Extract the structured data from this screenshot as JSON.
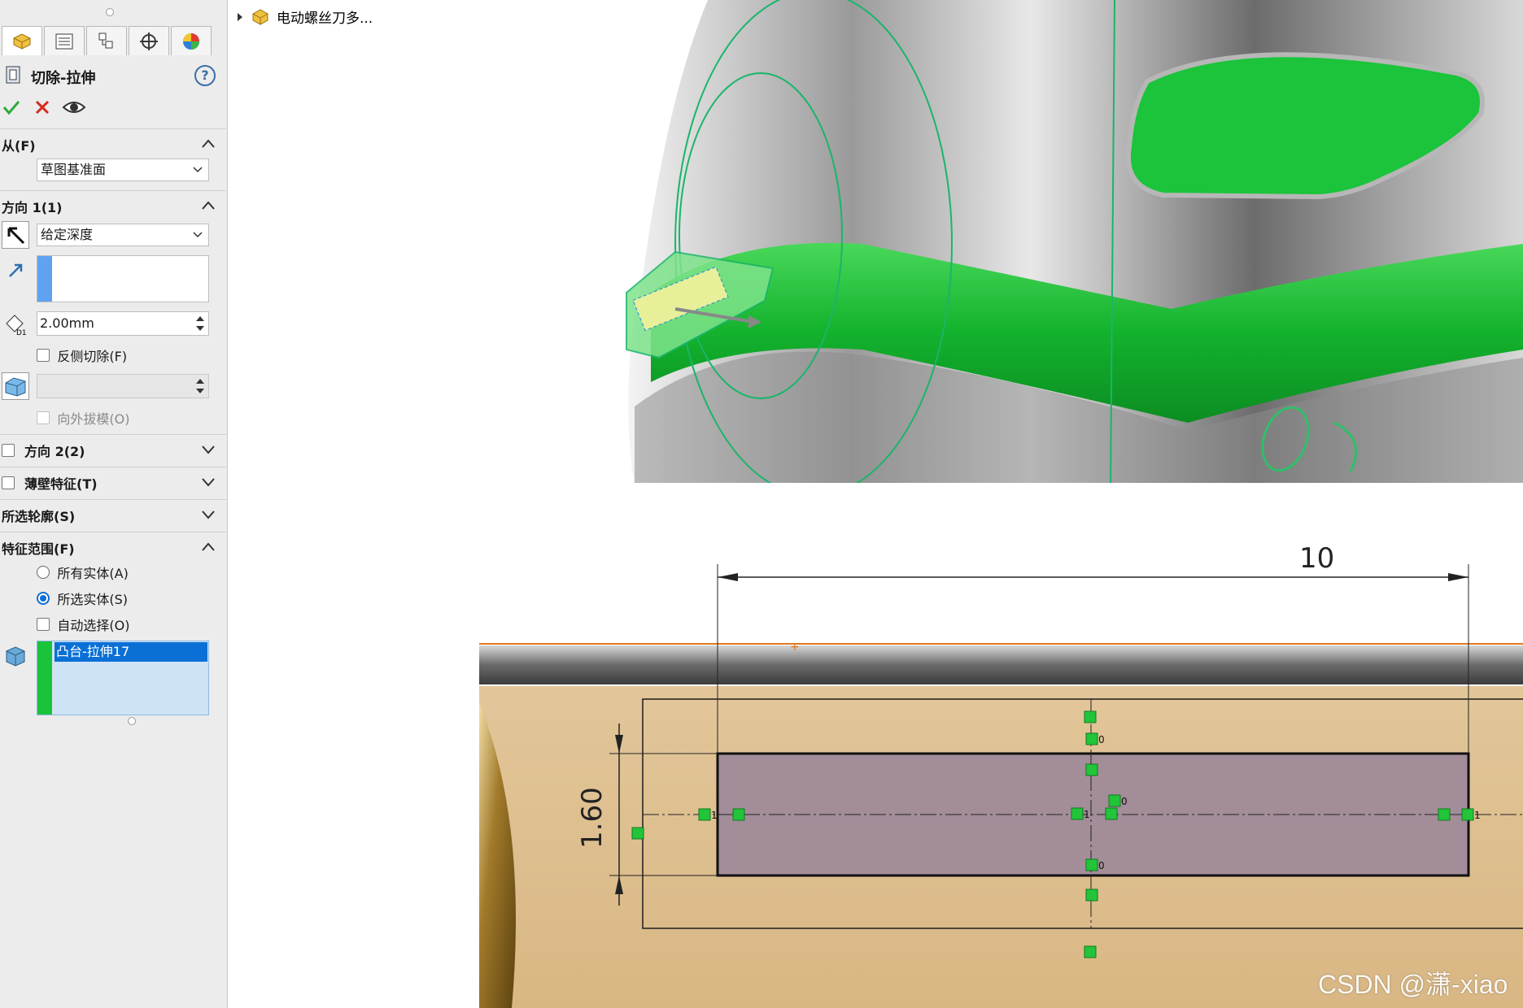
{
  "panel": {
    "tabs": [
      "featuremanager-icon",
      "propertymanager-icon",
      "configurationmanager-icon",
      "dimxpert-icon",
      "display-manager-icon"
    ],
    "title": "切除-拉伸",
    "help": "?",
    "sections": {
      "from": {
        "label": "从(F)",
        "value": "草图基准面"
      },
      "direction1": {
        "label": "方向 1(1)",
        "end_condition": "给定深度",
        "depth": "2.00mm",
        "flip_side_label": "反侧切除(F)",
        "draft_outward_label": "向外拔模(O)"
      },
      "direction2": {
        "label": "方向 2(2)"
      },
      "thin_feature": {
        "label": "薄壁特征(T)"
      },
      "selected_contours": {
        "label": "所选轮廓(S)"
      },
      "feature_scope": {
        "label": "特征范围(F)",
        "options": [
          "所有实体(A)",
          "所选实体(S)"
        ],
        "selected_option": "所选实体(S)",
        "auto_select_label": "自动选择(O)",
        "bodies": [
          "凸台-拉伸17"
        ]
      }
    }
  },
  "tree": {
    "item": "电动螺丝刀多..."
  },
  "sketch": {
    "width_dim": "10",
    "height_dim": "1.60",
    "relations": [
      "0",
      "0",
      "0",
      "0",
      "1",
      "1",
      "1"
    ]
  },
  "watermark": "CSDN @潇-xiao",
  "colors": {
    "accent_green": "#1fc43a",
    "selection_blue": "#0a70d6",
    "sketch_fill": "#a38d99",
    "wall_fill": "#dcbd8c"
  }
}
